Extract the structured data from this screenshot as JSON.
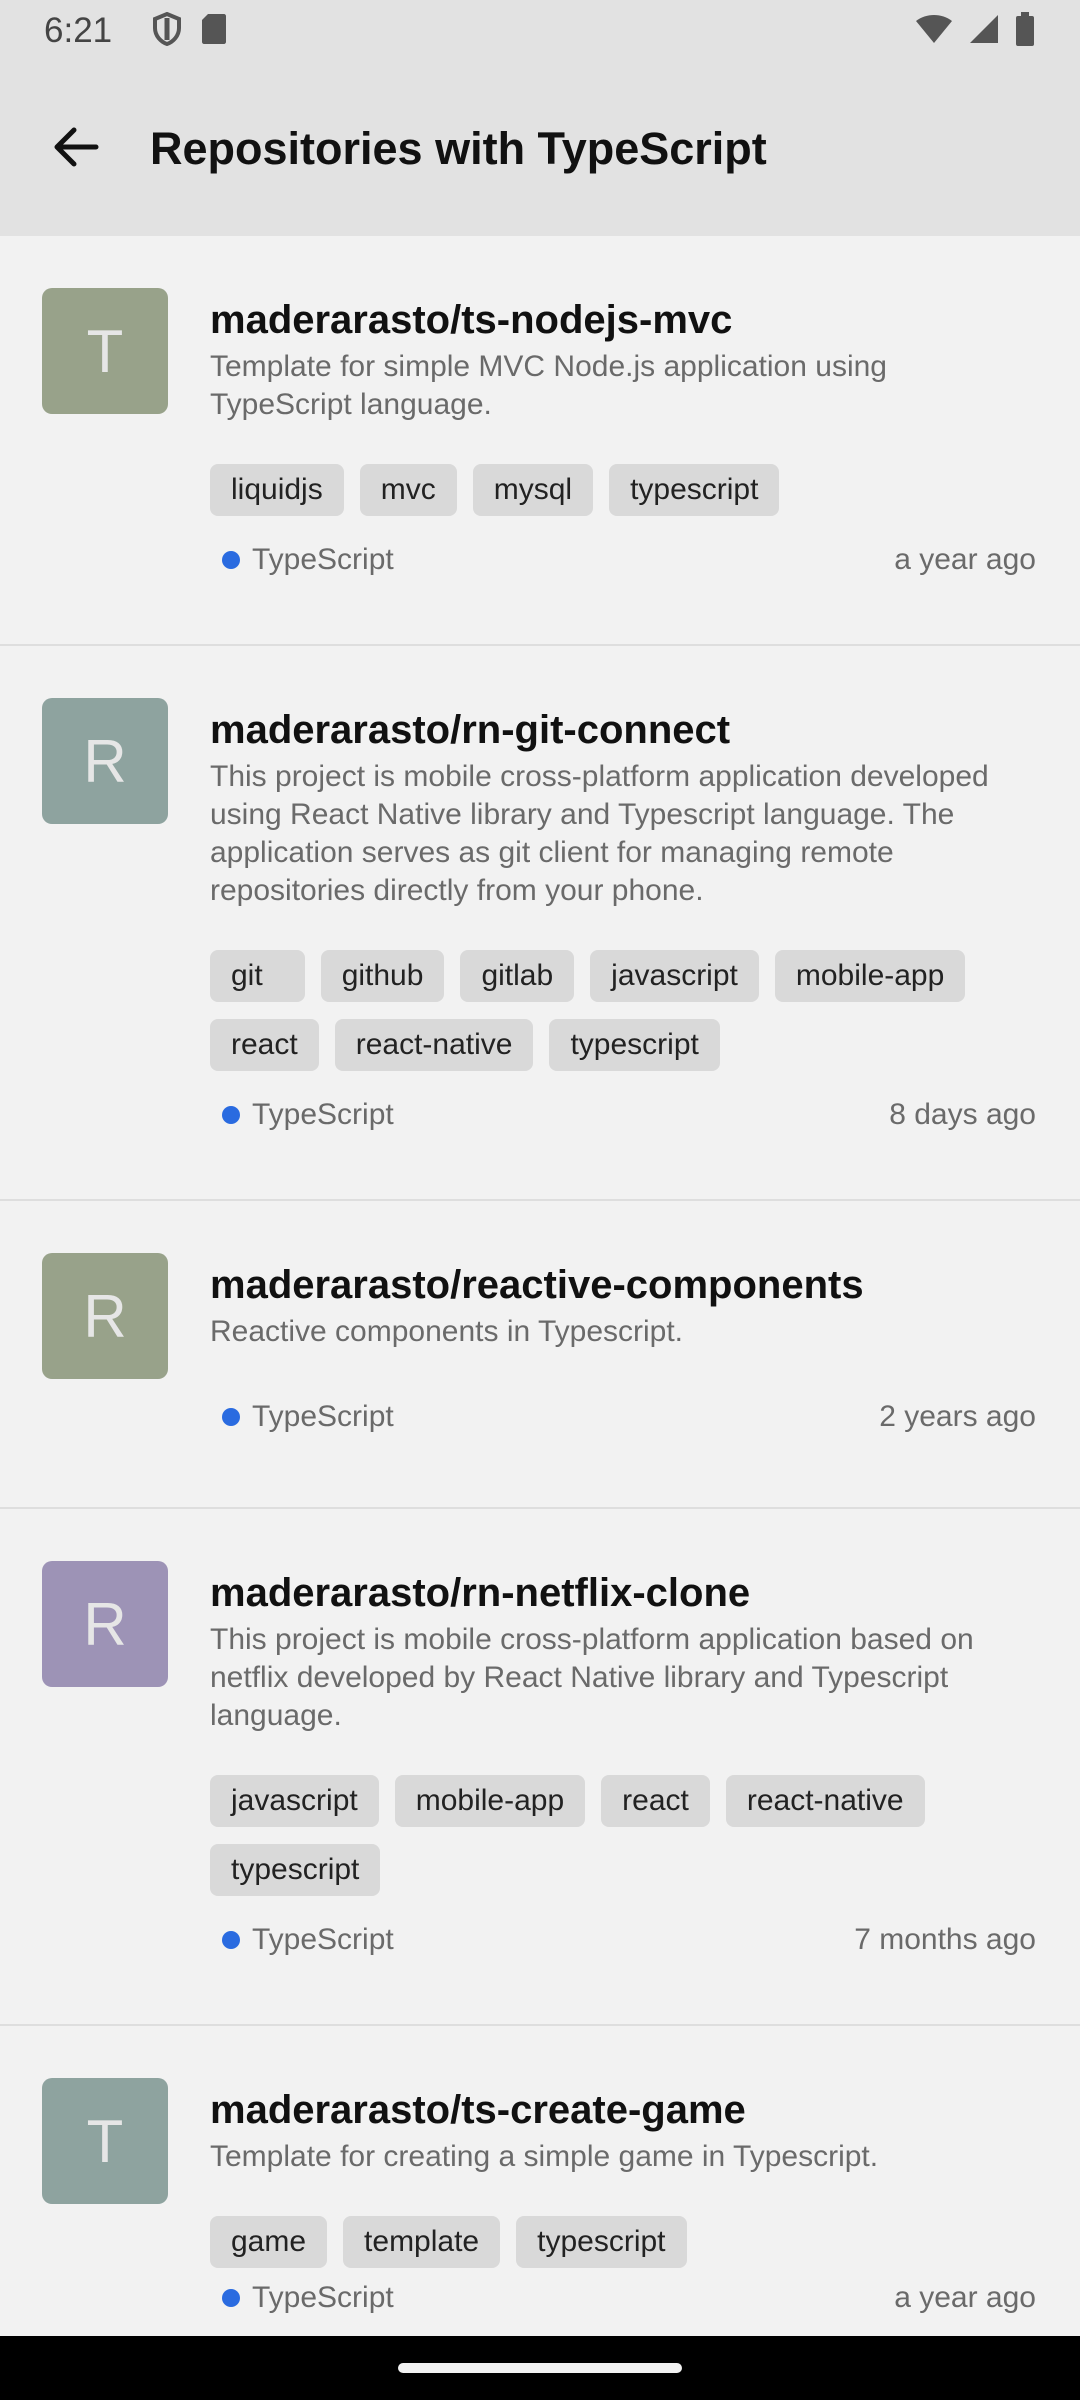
{
  "status_bar": {
    "time": "6:21",
    "icons": [
      "shield-icon",
      "sd-card-icon",
      "wifi-icon",
      "cellular-signal-icon",
      "battery-icon"
    ]
  },
  "app_bar": {
    "back_icon": "arrow-back-icon",
    "title": "Repositories with TypeScript"
  },
  "colors": {
    "language_dot": "#2a6be0",
    "avatar_t1": "#98a28a",
    "avatar_r1": "#8ea39f",
    "avatar_r2": "#98a28a",
    "avatar_r3": "#9d93b6",
    "avatar_t2": "#8ea39f"
  },
  "repos": [
    {
      "avatar_letter": "T",
      "name": "maderarasto/ts-nodejs-mvc",
      "description": "Template for simple MVC Node.js application using TypeScript language.",
      "tags": [
        "liquidjs",
        "mvc",
        "mysql",
        "typescript"
      ],
      "language": "TypeScript",
      "updated": "a year ago"
    },
    {
      "avatar_letter": "R",
      "name": "maderarasto/rn-git-connect",
      "description": "This project is mobile cross-platform application developed using React Native library and Typescript language. The application serves as git client for managing remote repositories directly from your phone.",
      "tags": [
        "git",
        "github",
        "gitlab",
        "javascript",
        "mobile-app",
        "react",
        "react-native",
        "typescript"
      ],
      "language": "TypeScript",
      "updated": "8 days ago"
    },
    {
      "avatar_letter": "R",
      "name": "maderarasto/reactive-components",
      "description": "Reactive components in Typescript.",
      "tags": [],
      "language": "TypeScript",
      "updated": "2 years ago"
    },
    {
      "avatar_letter": "R",
      "name": "maderarasto/rn-netflix-clone",
      "description": "This project is mobile cross-platform application based on netflix developed by React Native library and Typescript language.",
      "tags": [
        "javascript",
        "mobile-app",
        "react",
        "react-native",
        "typescript"
      ],
      "language": "TypeScript",
      "updated": "7 months ago"
    },
    {
      "avatar_letter": "T",
      "name": "maderarasto/ts-create-game",
      "description": "Template for creating a simple game in Typescript.",
      "tags": [
        "game",
        "template",
        "typescript"
      ],
      "language": "TypeScript",
      "updated": "a year ago"
    }
  ]
}
